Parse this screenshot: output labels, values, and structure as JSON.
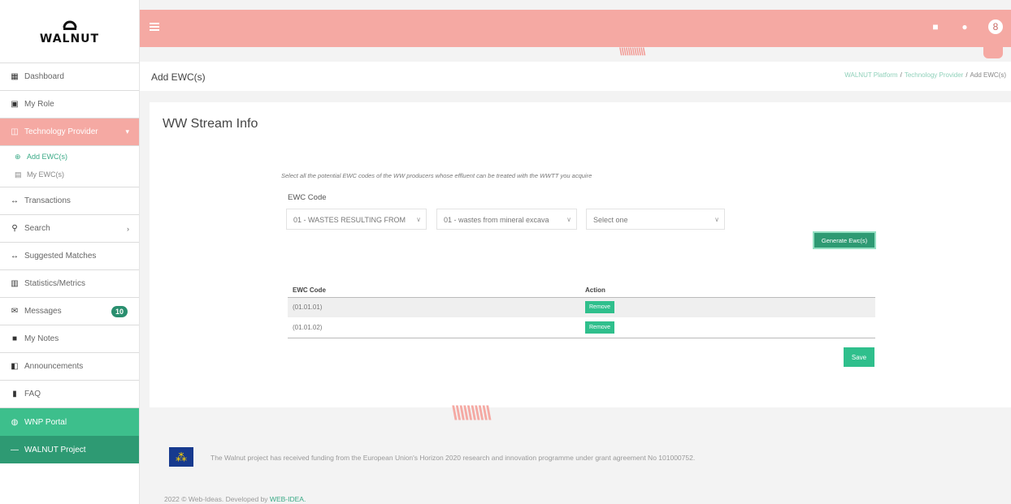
{
  "brand": {
    "name": "WALNUT"
  },
  "sidebar": {
    "items": [
      {
        "label": "Dashboard",
        "icon": "dashboard-icon"
      },
      {
        "label": "My Role",
        "icon": "briefcase-icon"
      },
      {
        "label": "Technology Provider",
        "icon": "grid-icon"
      },
      {
        "label": "Transactions",
        "icon": "arrows-icon"
      },
      {
        "label": "Search",
        "icon": "search-icon"
      },
      {
        "label": "Suggested Matches",
        "icon": "arrows-icon"
      },
      {
        "label": "Statistics/Metrics",
        "icon": "chart-icon"
      },
      {
        "label": "Messages",
        "icon": "envelope-icon",
        "badge": "10"
      },
      {
        "label": "My Notes",
        "icon": "note-icon"
      },
      {
        "label": "Announcements",
        "icon": "megaphone-icon"
      },
      {
        "label": "FAQ",
        "icon": "book-icon"
      },
      {
        "label": "WNP Portal",
        "icon": "globe-icon"
      },
      {
        "label": "WALNUT Project",
        "icon": "dash-icon"
      }
    ],
    "subitems": [
      {
        "label": "Add EWC(s)",
        "icon": "plus-circle-icon"
      },
      {
        "label": "My EWC(s)",
        "icon": "table-icon"
      }
    ]
  },
  "header": {
    "page_title": "Add EWC(s)",
    "breadcrumb": [
      "WALNUT Platform",
      "Technology Provider",
      "Add EWC(s)"
    ]
  },
  "card": {
    "title": "WW Stream Info",
    "instruction": "Select all the potential EWC codes of the WW producers whose effluent can be treated with the WWTT you acquire",
    "field_label": "EWC Code",
    "select1": "01 - WASTES RESULTING FROM",
    "select2": "01 - wastes from mineral excava",
    "select3": "Select one",
    "generate_label": "Generate Ewc(s)",
    "table": {
      "headers": [
        "EWC Code",
        "Action"
      ],
      "rows": [
        {
          "code": "(01.01.01)",
          "action": "Remove"
        },
        {
          "code": "(01.01.02)",
          "action": "Remove"
        }
      ]
    },
    "save_label": "Save"
  },
  "footer": {
    "funding": "The Walnut project has received funding from the European Union's Horizon 2020 research and innovation programme under grant agreement No 101000752.",
    "copyright_prefix": "2022 © Web-Ideas. Developed by",
    "copyright_link": "WEB-IDEA."
  },
  "colors": {
    "accent_pink": "#f5a9a3",
    "accent_green": "#2fbf8c",
    "dark_green": "#2e9a73"
  }
}
